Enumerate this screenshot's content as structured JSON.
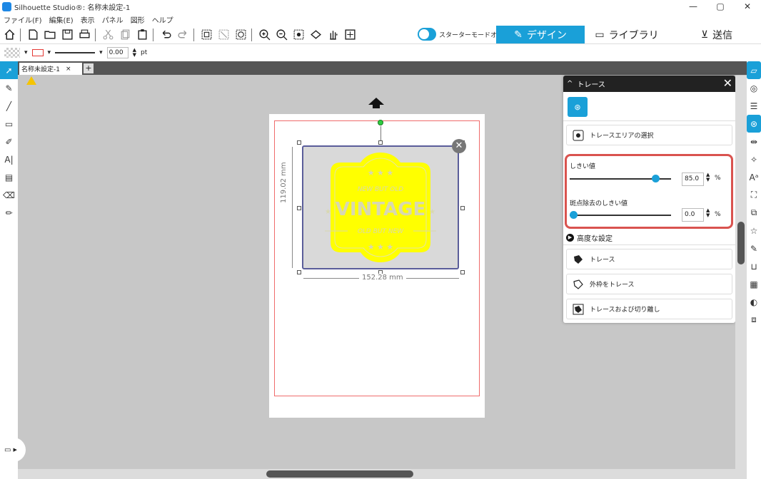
{
  "window": {
    "title": "Silhouette Studio®: 名称未設定-1",
    "controls": [
      "—",
      "▢",
      "✕"
    ]
  },
  "menu": [
    "ファイル(F)",
    "編集(E)",
    "表示",
    "パネル",
    "図形",
    "ヘルプ"
  ],
  "toolbar": {
    "starter_mode_label": "スターターモードオフ",
    "tabs": [
      {
        "label": "デザイン",
        "icon": "pencil-ruler-icon",
        "active": true
      },
      {
        "label": "ライブラリ",
        "icon": "folder-icon",
        "active": false
      },
      {
        "label": "送信",
        "icon": "send-icon",
        "active": false
      }
    ]
  },
  "propbar": {
    "line_width": "0.00",
    "unit": "pt"
  },
  "document": {
    "tab_label": "名称未設定-1",
    "tab_close": "×",
    "add_tab": "+"
  },
  "canvas": {
    "width_label": "152.28 mm",
    "height_label": "119.02 mm",
    "artwork": {
      "top_text": "NEW BUT OLD",
      "main_text": "VINTAGE",
      "bottom_text": "OLD BUT NEW",
      "fill_color": "#ffff00"
    }
  },
  "trace_panel": {
    "title": "トレース",
    "select_area_label": "トレースエリアの選択",
    "threshold_label": "しきい値",
    "threshold_value": "85.0",
    "threshold_percent": 85,
    "despeckle_label": "斑点除去のしきい値",
    "despeckle_value": "0.0",
    "despeckle_percent": 0,
    "percent_sign": "%",
    "advanced_label": "高度な設定",
    "trace_button": "トレース",
    "outer_trace_button": "外枠をトレース",
    "trace_detach_button": "トレースおよび切り離し"
  },
  "colors": {
    "accent": "#1aa0d8",
    "highlight": "#d9534f"
  }
}
